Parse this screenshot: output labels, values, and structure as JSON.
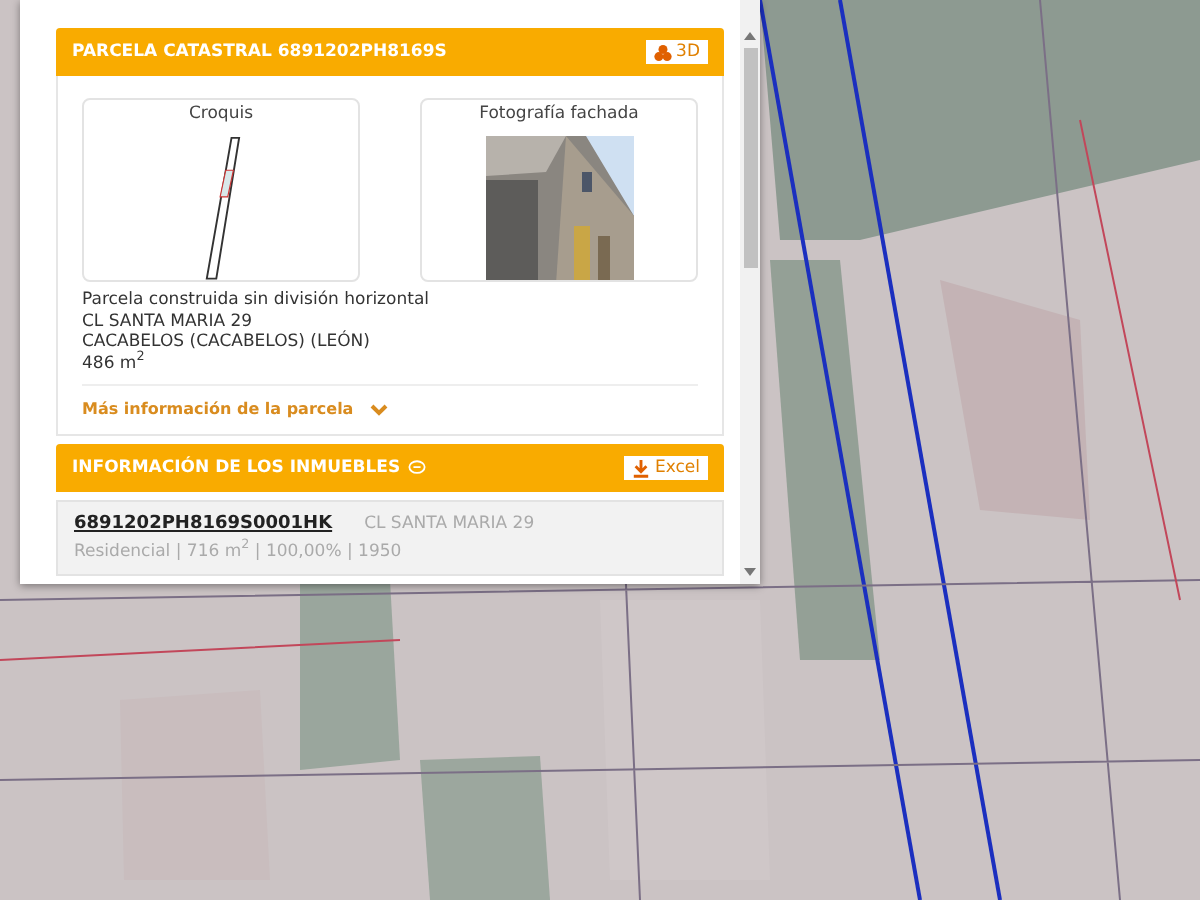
{
  "panel": {
    "parcel_card": {
      "title": "PARCELA CATASTRAL 6891202PH8169S",
      "button_3d": "3D",
      "sketch_label": "Croquis",
      "photo_label": "Fotografía fachada",
      "details": [
        "Parcela construida sin división horizontal",
        "CL SANTA MARIA 29",
        "CACABELOS (CACABELOS) (LEÓN)",
        "486 m$^{2}$"
      ],
      "more_link": "Más información de la parcela",
      "expanded": false
    },
    "properties": {
      "title": "INFORMACIÓN DE LOS INMUEBLES",
      "excel_button": "Excel",
      "items": [
        {
          "reference": "6891202PH8169S0001HK",
          "address": "CL SANTA MARIA 29",
          "details": "Residencial | 716 m$^{2}$ | 100,00% | 1950"
        }
      ]
    }
  }
}
